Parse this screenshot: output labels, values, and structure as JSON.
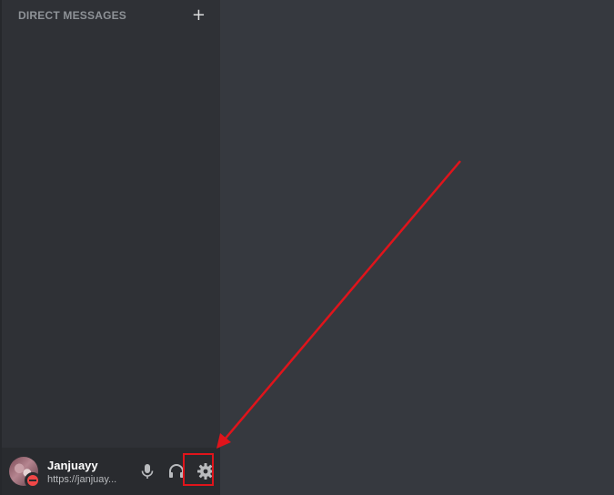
{
  "sidebar": {
    "section_title": "DIRECT MESSAGES",
    "add_dm_symbol": "+"
  },
  "user_panel": {
    "username": "Janjuayy",
    "custom_status": "https://janjuay...",
    "status": "do-not-disturb",
    "status_color": "#f04747"
  },
  "controls": {
    "mute_icon": "microphone-icon",
    "deafen_icon": "headphones-icon",
    "settings_icon": "gear-icon"
  },
  "annotation": {
    "color": "#e0141b",
    "target": "user-settings-button"
  }
}
